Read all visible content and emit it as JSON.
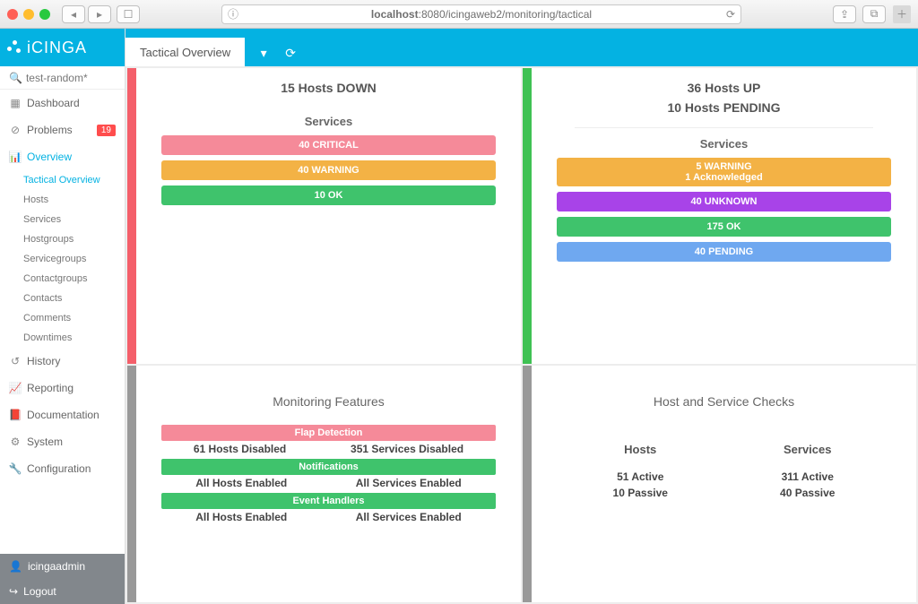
{
  "browser": {
    "url_display": "localhost:8080/icingaweb2/monitoring/tactical",
    "host_part": "localhost"
  },
  "brand": "iCINGA",
  "search": {
    "query": "test-random*"
  },
  "nav": {
    "dashboard": "Dashboard",
    "problems": "Problems",
    "problems_badge": "19",
    "overview": "Overview",
    "history": "History",
    "reporting": "Reporting",
    "documentation": "Documentation",
    "system": "System",
    "configuration": "Configuration"
  },
  "overview_sub": {
    "tactical": "Tactical Overview",
    "hosts": "Hosts",
    "services": "Services",
    "hostgroups": "Hostgroups",
    "servicegroups": "Servicegroups",
    "contactgroups": "Contactgroups",
    "contacts": "Contacts",
    "comments": "Comments",
    "downtimes": "Downtimes"
  },
  "footer": {
    "user": "icingaadmin",
    "logout": "Logout"
  },
  "tab": {
    "title": "Tactical Overview"
  },
  "panel_down": {
    "title": "15 Hosts DOWN",
    "services_label": "Services",
    "bars": {
      "critical": "40 CRITICAL",
      "warning": "40 WARNING",
      "ok": "10 OK"
    }
  },
  "panel_up": {
    "title1": "36 Hosts UP",
    "title2": "10 Hosts PENDING",
    "services_label": "Services",
    "bars": {
      "warning_l1": "5 WARNING",
      "warning_l2": "1 Acknowledged",
      "unknown": "40 UNKNOWN",
      "ok": "175 OK",
      "pending": "40 PENDING"
    }
  },
  "panel_features": {
    "title": "Monitoring Features",
    "flap": {
      "header": "Flap Detection",
      "left": "61 Hosts Disabled",
      "right": "351 Services Disabled"
    },
    "notif": {
      "header": "Notifications",
      "left": "All Hosts Enabled",
      "right": "All Services Enabled"
    },
    "events": {
      "header": "Event Handlers",
      "left": "All Hosts Enabled",
      "right": "All Services Enabled"
    }
  },
  "panel_checks": {
    "title": "Host and Service Checks",
    "hosts": {
      "label": "Hosts",
      "active": "51 Active",
      "passive": "10 Passive"
    },
    "services": {
      "label": "Services",
      "active": "311 Active",
      "passive": "40 Passive"
    }
  }
}
